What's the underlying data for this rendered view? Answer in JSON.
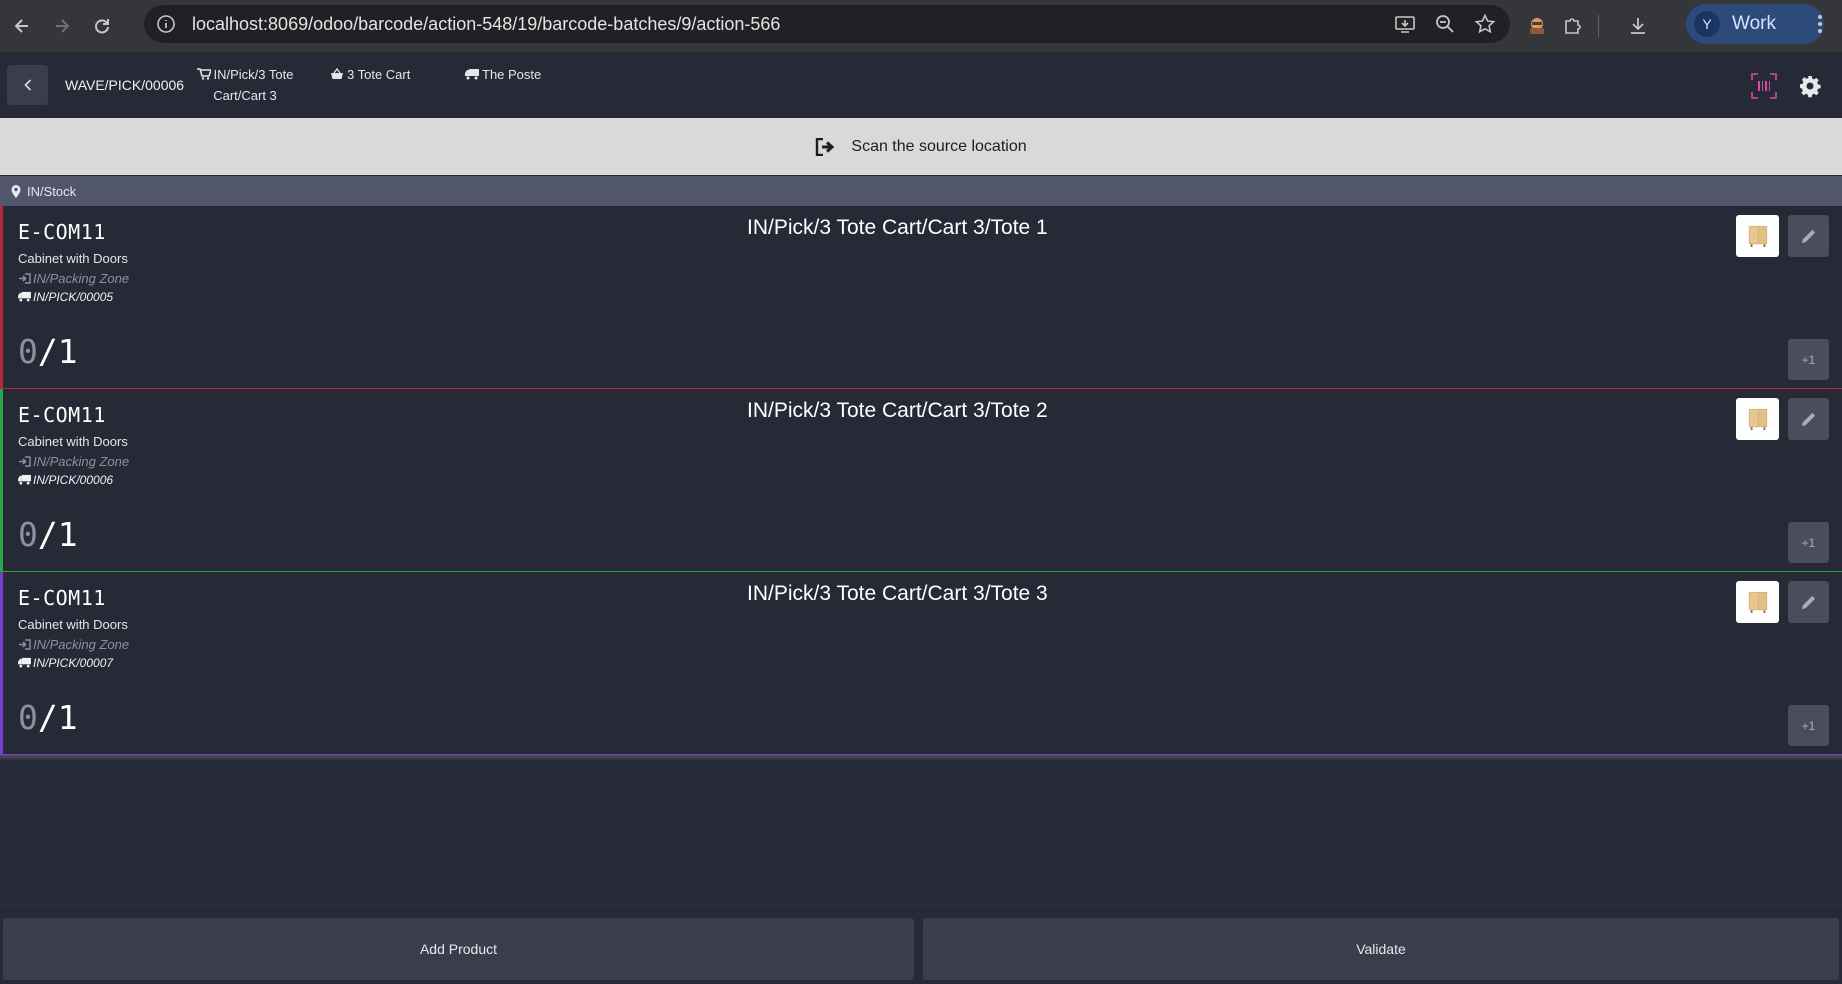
{
  "browser": {
    "url": "localhost:8069/odoo/barcode/action-548/19/barcode-batches/9/action-566",
    "profile_initial": "Y",
    "profile_name": "Work"
  },
  "header": {
    "batch_name": "WAVE/PICK/00006",
    "cart_line1": "IN/Pick/3 Tote",
    "cart_line2": "Cart/Cart 3",
    "totes": "3 Tote Cart",
    "carrier": "The Poste"
  },
  "banner": {
    "instruction": "Scan the source location"
  },
  "location": {
    "name": "IN/Stock"
  },
  "lines": [
    {
      "product_code": "E-COM11",
      "product_name": "Cabinet with Doors",
      "destination": "IN/Packing Zone",
      "picking": "IN/PICK/00005",
      "qty_done": "0",
      "qty_total": "/1",
      "tote": "IN/Pick/3 Tote Cart/Cart 3/Tote 1",
      "increment_label": "+1",
      "status_color": "#b02a37"
    },
    {
      "product_code": "E-COM11",
      "product_name": "Cabinet with Doors",
      "destination": "IN/Packing Zone",
      "picking": "IN/PICK/00006",
      "qty_done": "0",
      "qty_total": "/1",
      "tote": "IN/Pick/3 Tote Cart/Cart 3/Tote 2",
      "increment_label": "+1",
      "status_color": "#2aa44a"
    },
    {
      "product_code": "E-COM11",
      "product_name": "Cabinet with Doors",
      "destination": "IN/Packing Zone",
      "picking": "IN/PICK/00007",
      "qty_done": "0",
      "qty_total": "/1",
      "tote": "IN/Pick/3 Tote Cart/Cart 3/Tote 3",
      "increment_label": "+1",
      "status_color": "#7a3ad6"
    }
  ],
  "footer": {
    "add_product_label": "Add Product",
    "validate_label": "Validate"
  }
}
